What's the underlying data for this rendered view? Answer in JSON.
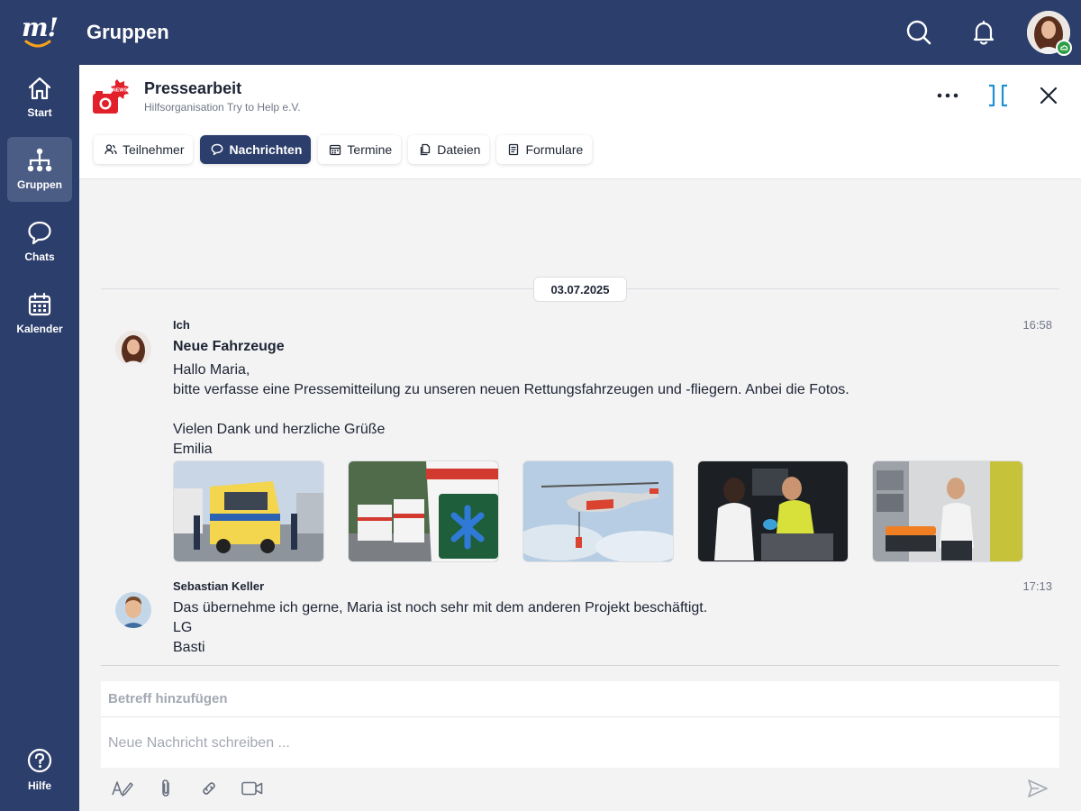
{
  "app": {
    "logo_text": "m!",
    "page_title": "Gruppen"
  },
  "nav": {
    "items": [
      {
        "label": "Start",
        "icon": "home-icon"
      },
      {
        "label": "Gruppen",
        "icon": "groups-icon",
        "active": true
      },
      {
        "label": "Chats",
        "icon": "chat-bubble-icon"
      },
      {
        "label": "Kalender",
        "icon": "calendar-icon"
      }
    ],
    "help": {
      "label": "Hilfe",
      "icon": "help-icon"
    }
  },
  "group": {
    "name": "Pressearbeit",
    "subtitle": "Hilfsorganisation Try to Help e.V.",
    "icon_badge": "NEWS"
  },
  "tabs": [
    {
      "label": "Teilnehmer",
      "icon": "people-icon"
    },
    {
      "label": "Nachrichten",
      "icon": "speech-bubble-icon",
      "active": true
    },
    {
      "label": "Termine",
      "icon": "calendar-icon"
    },
    {
      "label": "Dateien",
      "icon": "files-icon"
    },
    {
      "label": "Formulare",
      "icon": "form-icon"
    }
  ],
  "date_separator": "03.07.2025",
  "messages": [
    {
      "sender": "Ich",
      "time": "16:58",
      "subject": "Neue Fahrzeuge",
      "lines": [
        "Hallo Maria,",
        "bitte verfasse eine Pressemitteilung zu unseren neuen Rettungsfahrzeugen und -fliegern. Anbei die Fotos.",
        "",
        "Vielen Dank und herzliche Grüße",
        "Emilia"
      ],
      "attachments": 5
    },
    {
      "sender": "Sebastian Keller",
      "time": "17:13",
      "lines": [
        "Das übernehme ich gerne, Maria ist noch sehr mit dem anderen Projekt beschäftigt.",
        "LG",
        "Basti"
      ]
    }
  ],
  "composer": {
    "subject_placeholder": "Betreff hinzufügen",
    "body_placeholder": "Neue Nachricht schreiben ..."
  },
  "colors": {
    "navy": "#2c3e6b",
    "nav_active": "#4c5d85",
    "accent_blue": "#1f8fd6",
    "panel_bg": "#f3f3f4",
    "news_red": "#e2202a",
    "online_green": "#2e9e44"
  }
}
